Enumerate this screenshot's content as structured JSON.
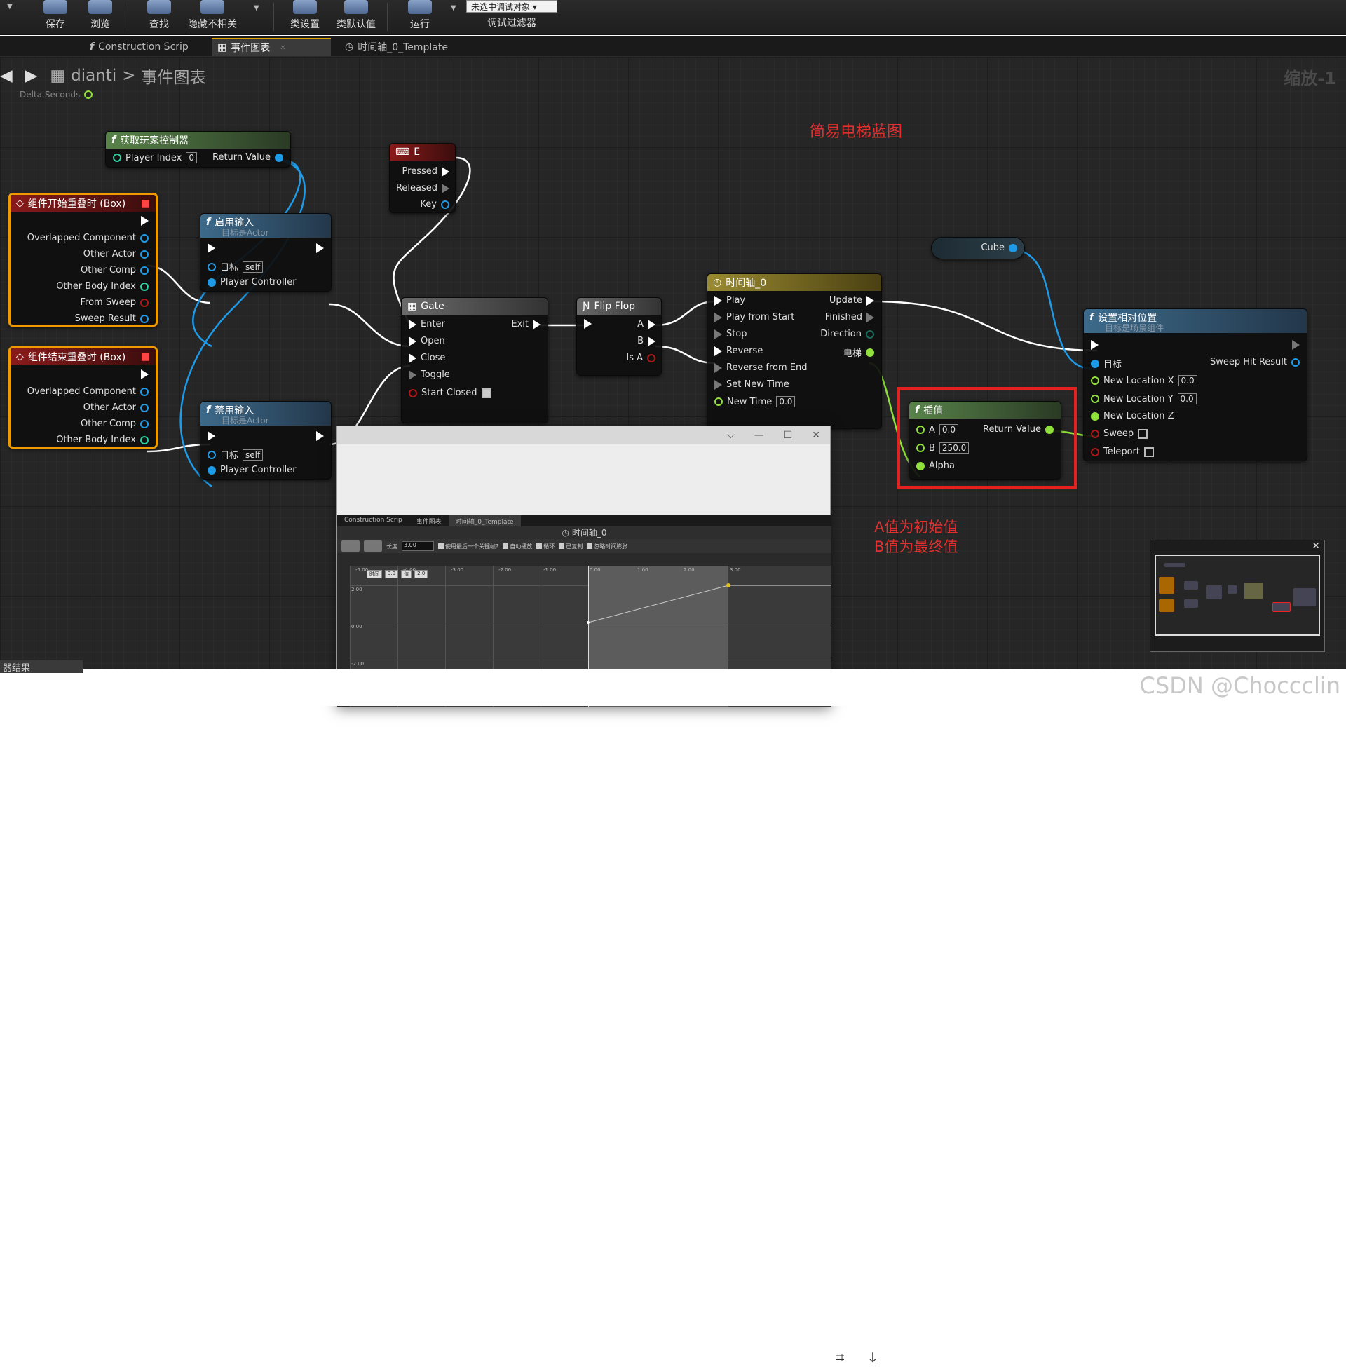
{
  "toolbar": {
    "buttons": [
      {
        "label": "保存"
      },
      {
        "label": "浏览"
      },
      {
        "label": "查找"
      },
      {
        "label": "隐藏不相关"
      },
      {
        "label": "类设置"
      },
      {
        "label": "类默认值"
      },
      {
        "label": "运行"
      }
    ],
    "debug_select": "未选中调试对象",
    "debug_filter": "调试过滤器"
  },
  "tabs": [
    {
      "label": "Construction Scrip"
    },
    {
      "label": "事件图表"
    },
    {
      "label": "时间轴_0_Template"
    }
  ],
  "breadcrumb": {
    "root": "dianti",
    "sep": ">",
    "current": "事件图表"
  },
  "zoom": "缩放-1",
  "delta_seconds": "Delta Seconds",
  "graph_title": "简易电梯蓝图",
  "nodes": {
    "get_player_controller": {
      "title": "获取玩家控制器",
      "player_index": "Player Index",
      "player_index_val": "0",
      "return_value": "Return Value"
    },
    "key_e": {
      "title": "E",
      "pressed": "Pressed",
      "released": "Released",
      "key": "Key"
    },
    "begin_overlap": {
      "title": "组件开始重叠时 (Box)",
      "pins": [
        "Overlapped Component",
        "Other Actor",
        "Other Comp",
        "Other Body Index",
        "From Sweep",
        "Sweep Result"
      ]
    },
    "end_overlap": {
      "title": "组件结束重叠时 (Box)",
      "pins": [
        "Overlapped Component",
        "Other Actor",
        "Other Comp",
        "Other Body Index"
      ]
    },
    "enable_input": {
      "title": "启用输入",
      "subtitle": "目标是Actor",
      "target": "目标",
      "self": "self",
      "pc": "Player Controller"
    },
    "disable_input": {
      "title": "禁用输入",
      "subtitle": "目标是Actor",
      "target": "目标",
      "self": "self",
      "pc": "Player Controller"
    },
    "gate": {
      "title": "Gate",
      "enter": "Enter",
      "exit": "Exit",
      "open": "Open",
      "close": "Close",
      "toggle": "Toggle",
      "start_closed": "Start Closed"
    },
    "flip_flop": {
      "title": "Flip Flop",
      "a": "A",
      "b": "B",
      "is_a": "Is A"
    },
    "timeline": {
      "title": "时间轴_0",
      "inputs": [
        "Play",
        "Play from Start",
        "Stop",
        "Reverse",
        "Reverse from End",
        "Set New Time",
        "New Time"
      ],
      "outputs": [
        "Update",
        "Finished",
        "Direction",
        "电梯"
      ],
      "new_time_val": "0.0"
    },
    "cube": {
      "label": "Cube"
    },
    "lerp": {
      "title": "插值",
      "a": "A",
      "a_val": "0.0",
      "b": "B",
      "b_val": "250.0",
      "alpha": "Alpha",
      "return_value": "Return Value"
    },
    "set_rel_loc": {
      "title": "设置相对位置",
      "subtitle": "目标是场景组件",
      "target": "目标",
      "sweep_hit": "Sweep Hit Result",
      "nlx": "New Location X",
      "nlx_val": "0.0",
      "nly": "New Location Y",
      "nly_val": "0.0",
      "nlz": "New Location Z",
      "sweep": "Sweep",
      "teleport": "Teleport"
    }
  },
  "annotation": {
    "line1": "A值为初始值",
    "line2": "B值为最终值"
  },
  "overlay": {
    "tabs": [
      "Construction Scrip",
      "事件图表",
      "时间轴_0_Template"
    ],
    "title": "时间轴_0",
    "length_label": "长度",
    "length_val": "3.00",
    "options": [
      "使用最后一个关键帧?",
      "自动播放",
      "循环",
      "已复制",
      "忽略时间膨胀"
    ],
    "ticks_x": [
      "-5.00",
      "-4.00",
      "-3.00",
      "-2.00",
      "-1.00",
      "0.00",
      "1.00",
      "2.00",
      "3.00"
    ],
    "ticks_y": [
      "2.00",
      "0.00",
      "-2.00"
    ],
    "key_time_label": "时间",
    "key_time_val": "3.0",
    "key_value_label": "值",
    "key_value_val": "2.0"
  },
  "watermark": "CSDN @Choccclin",
  "bottom_left": "器结果"
}
